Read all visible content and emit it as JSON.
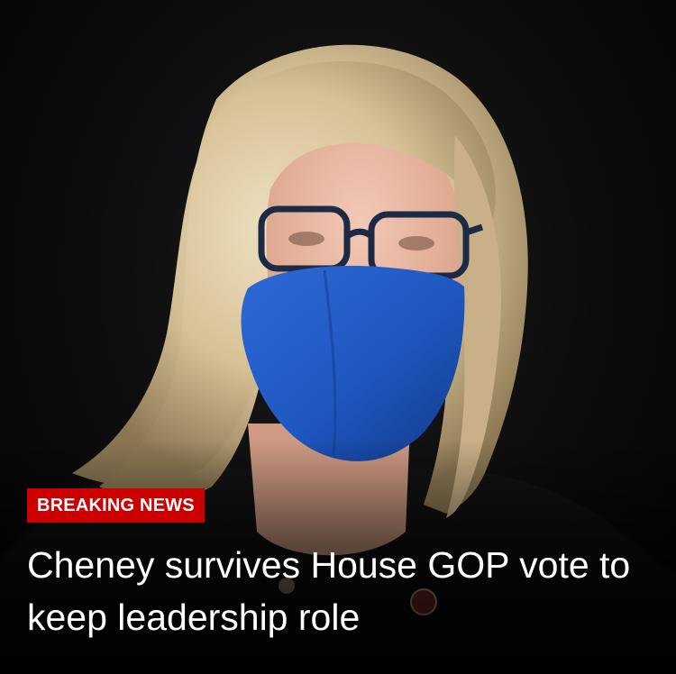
{
  "badge": {
    "label": "BREAKING NEWS",
    "color": "#cc0000"
  },
  "headline": {
    "text": "Cheney survives House GOP vote to keep leadership role"
  },
  "photo": {
    "mask_color": "#1f57c0",
    "hair_color": "#d8c39a",
    "background_color": "#0c0c0d"
  }
}
